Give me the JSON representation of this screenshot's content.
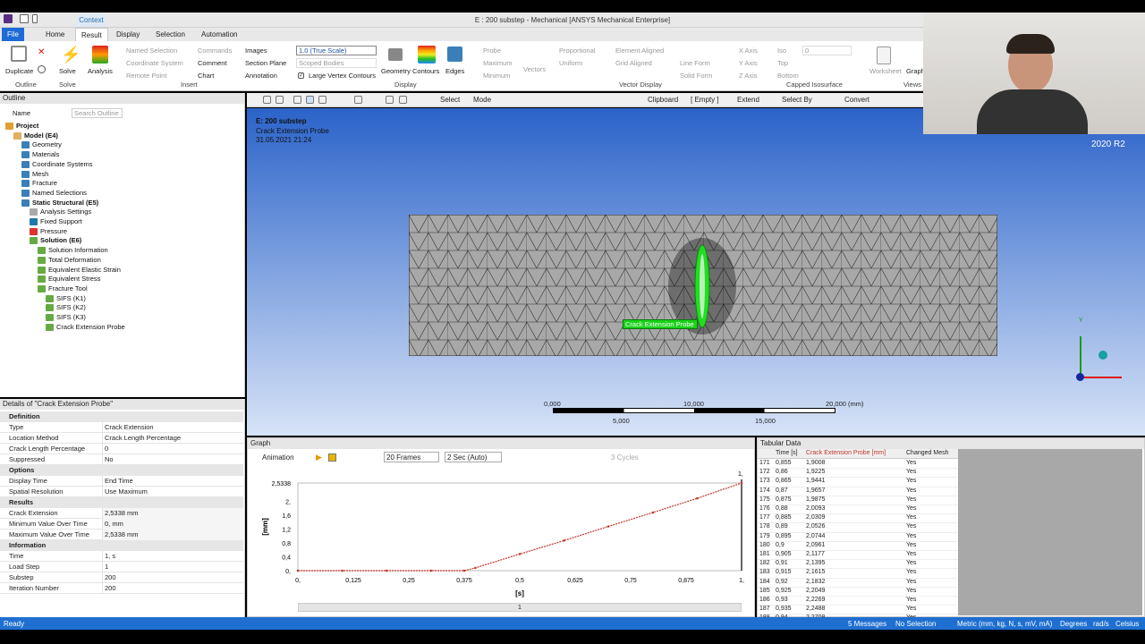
{
  "window": {
    "title": "E : 200 substep - Mechanical [ANSYS Mechanical Enterprise]",
    "context_tab": "Context"
  },
  "menu": [
    "File",
    "Home",
    "Result",
    "Display",
    "Selection",
    "Automation"
  ],
  "ribbon": {
    "duplicate": "Duplicate",
    "solve": "Solve",
    "analysis": "Analysis",
    "named_selection": "Named Selection",
    "coordinate_system": "Coordinate System",
    "remote_point": "Remote Point",
    "commands": "Commands",
    "comment": "Comment",
    "chart": "Chart",
    "images": "Images",
    "section_plane": "Section Plane",
    "annotation": "Annotation",
    "scale_value": "1.0 (True Scale)",
    "scoped_bodies": "Scoped Bodies",
    "large_vertex": "Large Vertex Contours",
    "geometry": "Geometry",
    "contours": "Contours",
    "edges": "Edges",
    "probe": "Probe",
    "maximum": "Maximum",
    "minimum": "Minimum",
    "vectors": "Vectors",
    "proportional": "Proportional",
    "uniform": "Uniform",
    "element_aligned": "Element Aligned",
    "grid_aligned": "Grid Aligned",
    "line_form": "Line Form",
    "solid_form": "Solid Form",
    "x_axis": "X Axis",
    "y_axis": "Y Axis",
    "z_axis": "Z Axis",
    "iso": "Iso",
    "top": "Top",
    "bottom": "Bottom",
    "iso_value": "0",
    "worksheet": "Worksheet",
    "graph": "Graph",
    "groups": {
      "outline": "Outline",
      "solve": "Solve",
      "insert": "Insert",
      "display": "Display",
      "vector_display": "Vector Display",
      "capped": "Capped Isosurface",
      "views": "Views"
    }
  },
  "toolbar": {
    "select": "Select",
    "mode": "Mode",
    "clipboard": "Clipboard",
    "empty": "[ Empty ]",
    "extend": "Extend",
    "select_by": "Select By",
    "convert": "Convert"
  },
  "outline": {
    "title": "Outline",
    "name_label": "Name",
    "search_placeholder": "Search Outline",
    "items": [
      "Project",
      "Model (E4)",
      "Geometry",
      "Materials",
      "Coordinate Systems",
      "Mesh",
      "Fracture",
      "Named Selections",
      "Static Structural (E5)",
      "Analysis Settings",
      "Fixed Support",
      "Pressure",
      "Solution (E6)",
      "Solution Information",
      "Total Deformation",
      "Equivalent Elastic Strain",
      "Equivalent Stress",
      "Fracture Tool",
      "SIFS (K1)",
      "SIFS (K2)",
      "SIFS (K3)",
      "Crack Extension Probe"
    ]
  },
  "details": {
    "title": "Details of \"Crack Extension Probe\"",
    "sections": [
      {
        "name": "Definition",
        "rows": [
          [
            "Type",
            "Crack Extension"
          ],
          [
            "Location Method",
            "Crack Length Percentage"
          ],
          [
            "Crack Length Percentage",
            "0"
          ],
          [
            "Suppressed",
            "No"
          ]
        ]
      },
      {
        "name": "Options",
        "rows": [
          [
            "Display Time",
            "End Time"
          ],
          [
            "Spatial Resolution",
            "Use Maximum"
          ]
        ]
      },
      {
        "name": "Results",
        "rows": [
          [
            "Crack Extension",
            "2,5338 mm"
          ],
          [
            "Minimum Value Over Time",
            "0, mm"
          ],
          [
            "Maximum Value Over Time",
            "2,5338 mm"
          ]
        ]
      },
      {
        "name": "Information",
        "rows": [
          [
            "Time",
            "1, s"
          ],
          [
            "Load Step",
            "1"
          ],
          [
            "Substep",
            "200"
          ],
          [
            "Iteration Number",
            "200"
          ]
        ]
      }
    ]
  },
  "viewport": {
    "header": [
      "E: 200 substep",
      "Crack Extension Probe",
      "31.05.2021 21:24"
    ],
    "probe_label": "Crack Extension Probe",
    "version": "2020 R2",
    "scale": {
      "ticks_top": [
        "0,000",
        "10,000",
        "20,000 (mm)"
      ],
      "ticks_bottom": [
        "5,000",
        "15,000"
      ]
    },
    "axis_y": "Y"
  },
  "graph": {
    "title": "Graph",
    "animation": "Animation",
    "frames": "20 Frames",
    "duration": "2 Sec (Auto)",
    "cycles": "3 Cycles",
    "page": "1",
    "color": "#c0392b"
  },
  "chart_data": {
    "type": "line",
    "xlabel": "[s]",
    "ylabel": "[mm]",
    "xlim": [
      0,
      1
    ],
    "ylim": [
      0,
      2.5338
    ],
    "x_ticks": [
      "0,",
      "0,125",
      "0,25",
      "0,375",
      "0,5",
      "0,625",
      "0,75",
      "0,875",
      "1,"
    ],
    "y_ticks": [
      "0,",
      "0,4",
      "0,8",
      "1,2",
      "1,6",
      "2,",
      "2,5338"
    ],
    "top_right_label": "1,",
    "series": [
      {
        "x": [
          0,
          0.1,
          0.2,
          0.3,
          0.375,
          0.4,
          0.5,
          0.6,
          0.7,
          0.8,
          0.9,
          1.0
        ],
        "values": [
          0,
          0,
          0,
          0,
          0,
          0.08,
          0.48,
          0.87,
          1.28,
          1.68,
          2.09,
          2.5338
        ]
      }
    ]
  },
  "tabular": {
    "title": "Tabular Data",
    "columns": [
      "Time [s]",
      "Crack Extension Probe [mm]",
      "Changed Mesh"
    ],
    "rows": [
      [
        "171",
        "0,855",
        "1,9008",
        "Yes"
      ],
      [
        "172",
        "0,86",
        "1,9225",
        "Yes"
      ],
      [
        "173",
        "0,865",
        "1,9441",
        "Yes"
      ],
      [
        "174",
        "0,87",
        "1,9657",
        "Yes"
      ],
      [
        "175",
        "0,875",
        "1,9875",
        "Yes"
      ],
      [
        "176",
        "0,88",
        "2,0093",
        "Yes"
      ],
      [
        "177",
        "0,885",
        "2,0309",
        "Yes"
      ],
      [
        "178",
        "0,89",
        "2,0526",
        "Yes"
      ],
      [
        "179",
        "0,895",
        "2,0744",
        "Yes"
      ],
      [
        "180",
        "0,9",
        "2,0961",
        "Yes"
      ],
      [
        "181",
        "0,905",
        "2,1177",
        "Yes"
      ],
      [
        "182",
        "0,91",
        "2,1395",
        "Yes"
      ],
      [
        "183",
        "0,915",
        "2,1615",
        "Yes"
      ],
      [
        "184",
        "0,92",
        "2,1832",
        "Yes"
      ],
      [
        "185",
        "0,925",
        "2,2049",
        "Yes"
      ],
      [
        "186",
        "0,93",
        "2,2269",
        "Yes"
      ],
      [
        "187",
        "0,935",
        "2,2488",
        "Yes"
      ],
      [
        "188",
        "0,94",
        "2,2708",
        "Yes"
      ]
    ]
  },
  "status": {
    "ready": "Ready",
    "messages": "5 Messages",
    "selection": "No Selection",
    "units": "Metric (mm, kg, N, s, mV, mA)",
    "degrees": "Degrees",
    "rads": "rad/s",
    "temp": "Celsius"
  }
}
